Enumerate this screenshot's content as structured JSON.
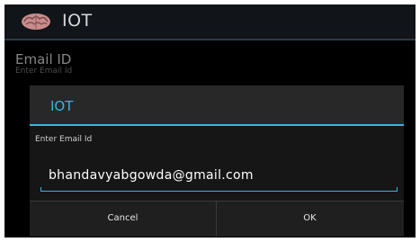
{
  "app": {
    "title": "IOT",
    "icon": "pink-brain-icon"
  },
  "preference": {
    "title": "Email ID",
    "summary": "Enter Email Id"
  },
  "dialog": {
    "title": "IOT",
    "message": "Enter Email Id",
    "input_value": "bhandavyabgowda@gmail.com",
    "cancel_label": "Cancel",
    "ok_label": "OK"
  },
  "colors": {
    "accent": "#33b5e5",
    "background": "#000000",
    "dialog": "#282828"
  }
}
